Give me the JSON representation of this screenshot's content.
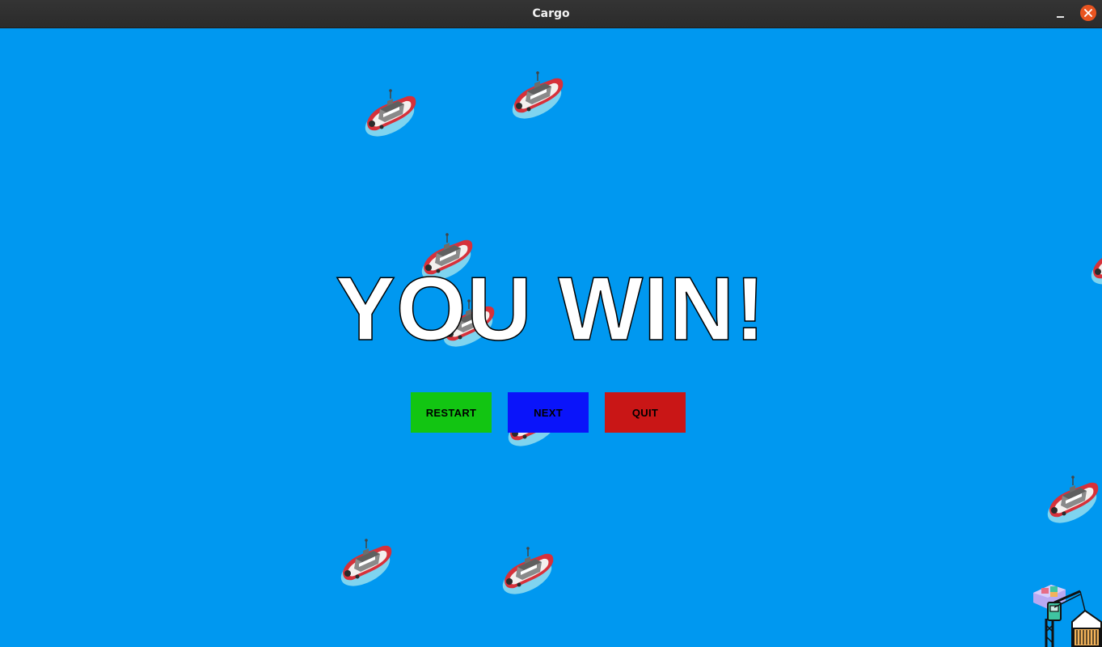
{
  "window": {
    "title": "Cargo",
    "minimize_icon": "minimize-icon",
    "close_icon": "close-icon"
  },
  "game": {
    "background_color": "#0098f0",
    "headline": "YOU WIN!",
    "buttons": {
      "restart_label": "RESTART",
      "next_label": "NEXT",
      "quit_label": "QUIT",
      "restart_color": "#12c512",
      "next_color": "#0a14fa",
      "quit_color": "#c91616"
    },
    "sprites": {
      "boat": "tugboat-icon",
      "port": "port-crane-icon"
    }
  }
}
